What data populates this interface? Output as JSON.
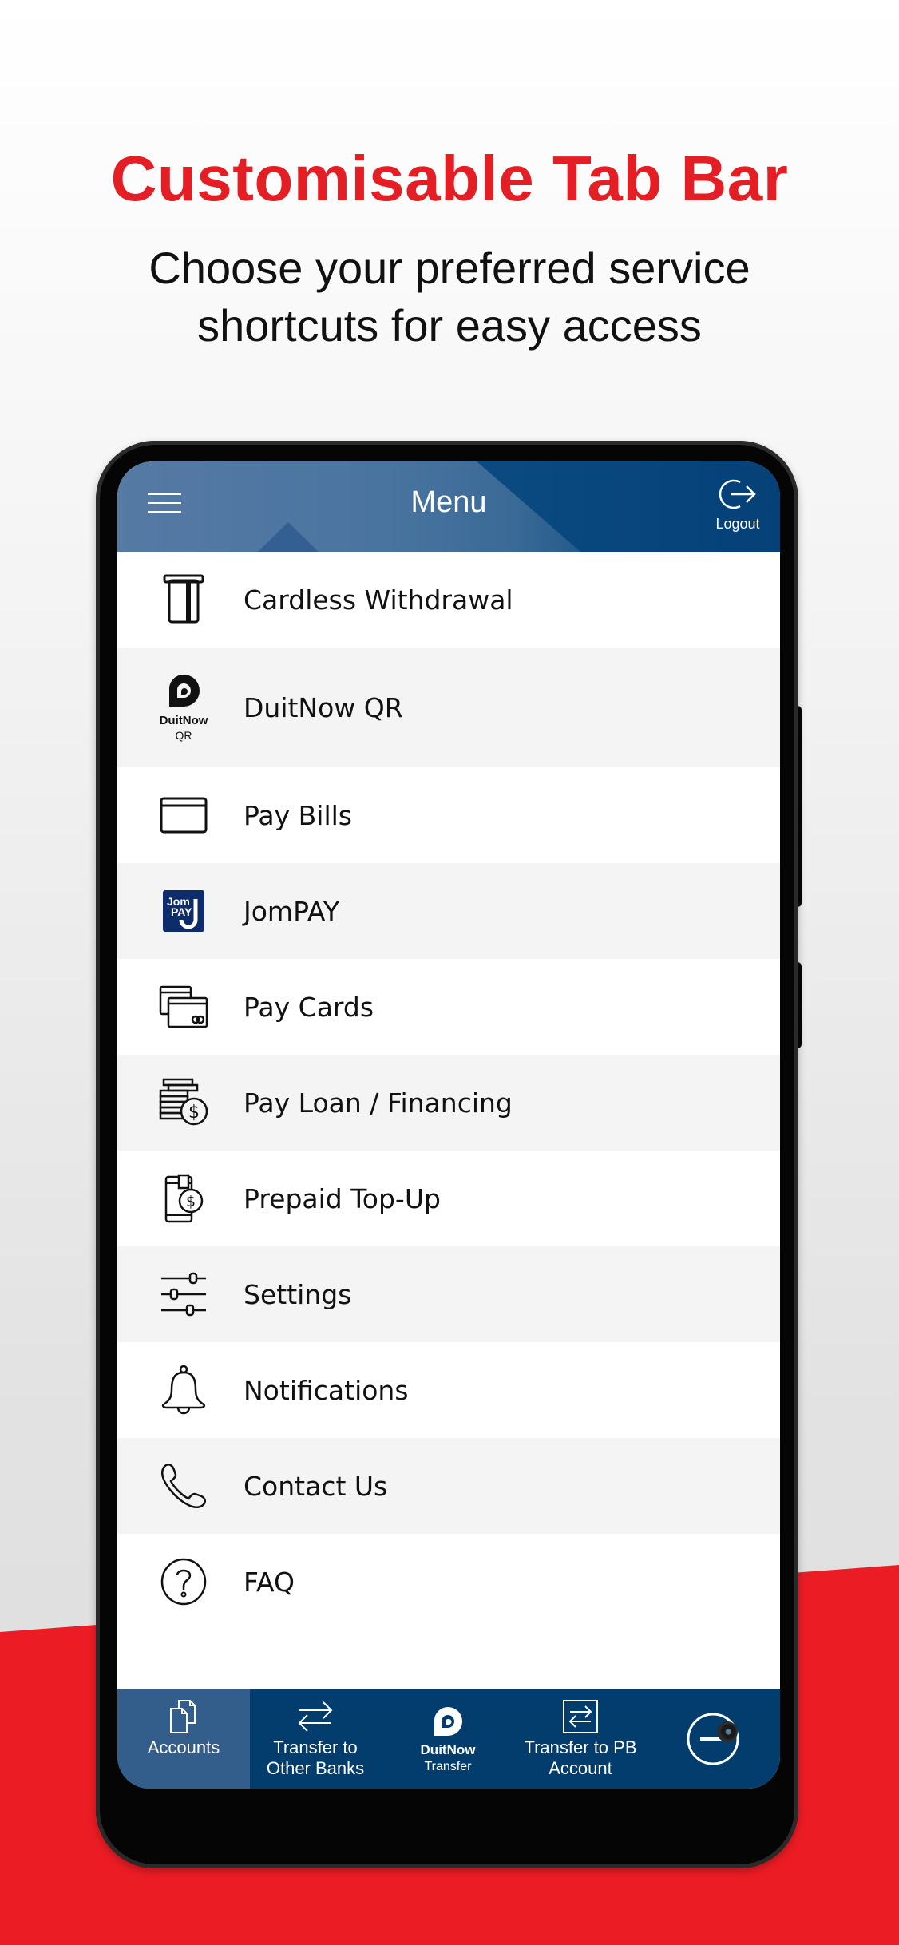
{
  "promo": {
    "title": "Customisable Tab Bar",
    "subtitle_lines": [
      "Choose your preferred service",
      "shortcuts for easy access"
    ],
    "colors": {
      "title_red": "#e31e24",
      "band_red": "#ec1c24"
    }
  },
  "header": {
    "title": "Menu",
    "menu_icon": "hamburger-icon",
    "logout_label": "Logout",
    "logout_icon": "logout-icon",
    "color": "#0c4a80"
  },
  "menu": {
    "items": [
      {
        "label": "Cardless Withdrawal",
        "icon": "cardless-withdrawal-icon"
      },
      {
        "label": "DuitNow QR",
        "icon": "duitnow-qr-icon",
        "icon_text": [
          "DuitNow",
          "QR"
        ]
      },
      {
        "label": "Pay Bills",
        "icon": "bill-icon"
      },
      {
        "label": "JomPAY",
        "icon": "jompay-icon",
        "icon_text": [
          "Jom",
          "PAY"
        ]
      },
      {
        "label": "Pay Cards",
        "icon": "credit-cards-icon"
      },
      {
        "label": "Pay Loan / Financing",
        "icon": "coins-dollar-icon"
      },
      {
        "label": "Prepaid Top-Up",
        "icon": "phone-dollar-icon"
      },
      {
        "label": "Settings",
        "icon": "sliders-icon"
      },
      {
        "label": "Notifications",
        "icon": "bell-icon"
      },
      {
        "label": "Contact Us",
        "icon": "phone-icon"
      },
      {
        "label": "FAQ",
        "icon": "question-circle-icon"
      }
    ]
  },
  "tabbar": {
    "tabs": [
      {
        "label": "Accounts",
        "icon": "documents-icon",
        "active": true
      },
      {
        "label_lines": [
          "Transfer to",
          "Other Banks"
        ],
        "icon": "swap-arrows-icon",
        "active": false
      },
      {
        "brand": "DuitNow",
        "sub": "Transfer",
        "icon": "duitnow-icon",
        "active": false
      },
      {
        "label_lines": [
          "Transfer to PB",
          "Account"
        ],
        "icon": "transfer-box-icon",
        "active": false
      },
      {
        "icon": "minus-circle-icon",
        "active": false
      }
    ],
    "color": "#033d6e",
    "active_color": "#335e8b"
  }
}
